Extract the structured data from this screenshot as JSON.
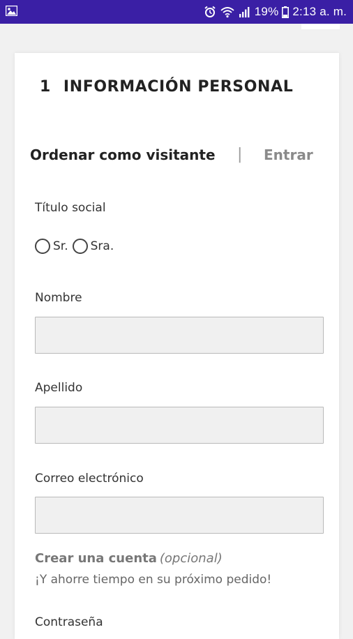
{
  "status_bar": {
    "battery_percent": "19%",
    "time": "2:13 a. m.",
    "icons": [
      "image-notification-icon",
      "alarm-icon",
      "wifi-icon",
      "signal-icon",
      "battery-icon"
    ],
    "background_color": "#3a1fa5"
  },
  "form": {
    "step_number": "1",
    "section_title": "INFORMACIÓN PERSONAL",
    "tabs": {
      "guest_label": "Ordenar como visitante",
      "separator": "|",
      "login_label": "Entrar"
    },
    "title_social": {
      "label": "Título social",
      "options": [
        "Sr.",
        "Sra."
      ]
    },
    "first_name": {
      "label": "Nombre",
      "value": ""
    },
    "last_name": {
      "label": "Apellido",
      "value": ""
    },
    "email": {
      "label": "Correo electrónico",
      "value": ""
    },
    "create_account": {
      "title": "Crear una cuenta",
      "optional": "(opcional)",
      "subtitle": "¡Y ahorre tiempo en su próximo pedido!"
    },
    "password": {
      "label": "Contraseña"
    }
  }
}
